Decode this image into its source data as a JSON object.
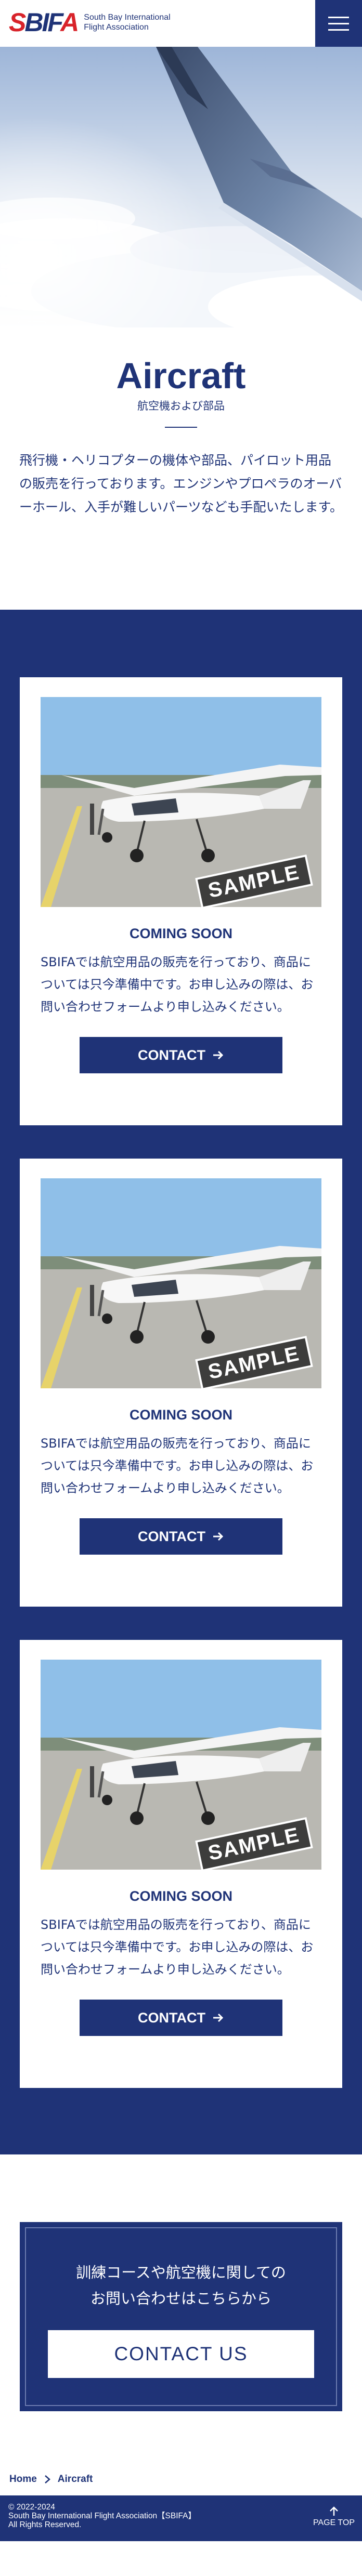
{
  "header": {
    "logo_text": "SBIFA",
    "org_name_line1": "South Bay International",
    "org_name_line2": "Flight Association"
  },
  "page": {
    "title": "Aircraft",
    "subtitle": "航空機および部品",
    "intro": "飛行機・ヘリコプターの機体や部品、パイロット用品の販売を行っております。エンジンやプロペラのオーバーホール、入手が難しいパーツなども手配いたします。"
  },
  "products": [
    {
      "stamp": "SAMPLE",
      "heading": "COMING SOON",
      "text": "SBIFAでは航空用品の販売を行っており、商品については只今準備中です。お申し込みの際は、お問い合わせフォームより申し込みください。",
      "button": "CONTACT"
    },
    {
      "stamp": "SAMPLE",
      "heading": "COMING SOON",
      "text": "SBIFAでは航空用品の販売を行っており、商品については只今準備中です。お申し込みの際は、お問い合わせフォームより申し込みください。",
      "button": "CONTACT"
    },
    {
      "stamp": "SAMPLE",
      "heading": "COMING SOON",
      "text": "SBIFAでは航空用品の販売を行っており、商品については只今準備中です。お申し込みの際は、お問い合わせフォームより申し込みください。",
      "button": "CONTACT"
    }
  ],
  "contact_banner": {
    "line1": "訓練コースや航空機に関しての",
    "line2": "お問い合わせはこちらから",
    "button": "CONTACT US"
  },
  "breadcrumb": [
    "Home",
    "Aircraft"
  ],
  "footer": {
    "copyright": "© 2022-2024",
    "org": "South Bay International Flight Association【SBIFA】",
    "rights": "All Rights Reserved.",
    "page_top": "PAGE TOP"
  },
  "colors": {
    "brand_navy": "#1f3377",
    "brand_red": "#d8232a",
    "background": "#ffffff"
  }
}
